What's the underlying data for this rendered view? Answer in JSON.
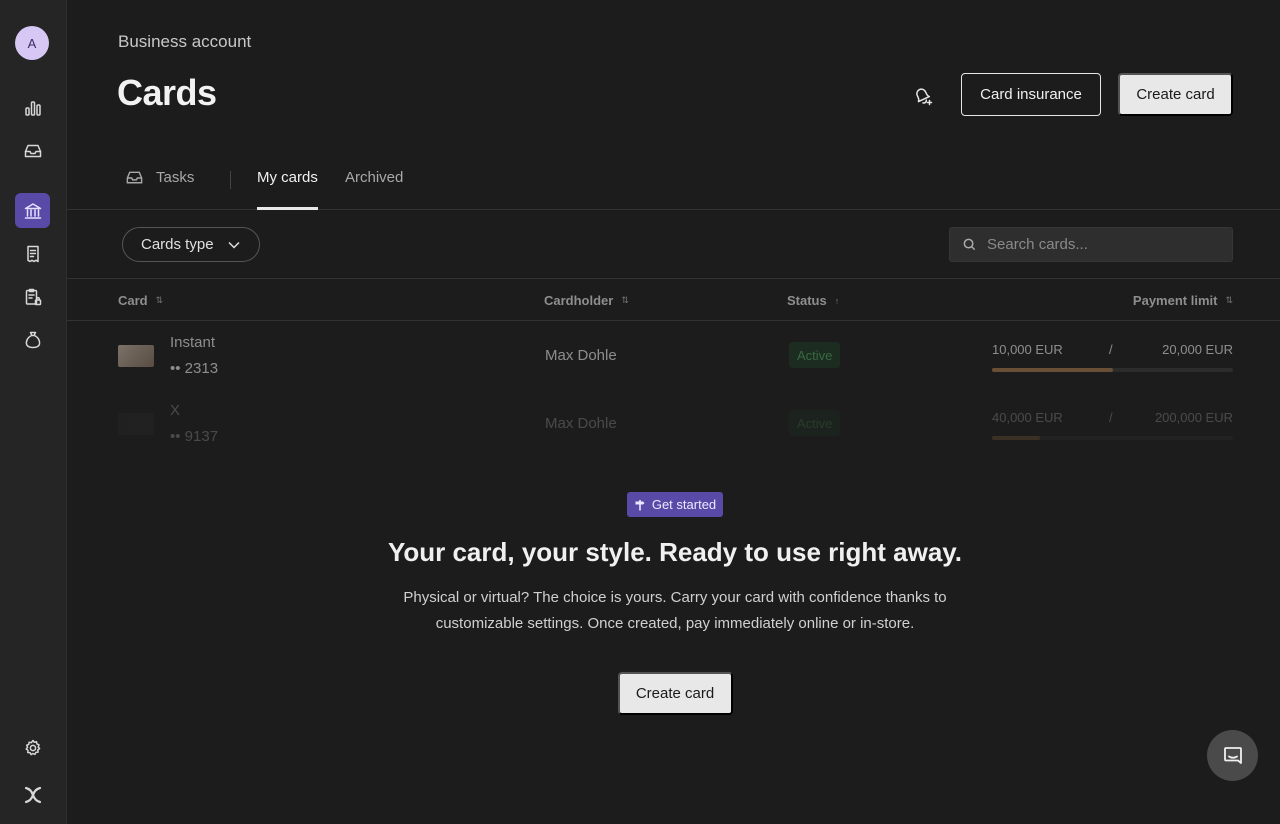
{
  "sidebar": {
    "avatar_initial": "A",
    "items": [
      {
        "icon": "bar-chart-icon"
      },
      {
        "icon": "inbox-icon"
      },
      {
        "icon": "bank-icon",
        "active": true
      },
      {
        "icon": "receipt-icon"
      },
      {
        "icon": "clipboard-lock-icon"
      },
      {
        "icon": "money-bag-icon"
      }
    ],
    "bottom": [
      {
        "icon": "gear-icon"
      },
      {
        "icon": "logo-icon"
      }
    ]
  },
  "header": {
    "eyebrow": "Business account",
    "title": "Cards",
    "insurance_label": "Card insurance",
    "create_label": "Create card"
  },
  "tabs": [
    {
      "label": "Tasks",
      "icon": "inbox-icon"
    },
    {
      "label": "My cards",
      "active": true
    },
    {
      "label": "Archived"
    }
  ],
  "filters": {
    "cards_type_label": "Cards type",
    "search_placeholder": "Search cards..."
  },
  "table": {
    "columns": [
      "Card",
      "Cardholder",
      "Status",
      "Payment limit"
    ],
    "rows": [
      {
        "name": "Instant",
        "number": "•• 2313",
        "holder": "Max Dohle",
        "status": "Active",
        "used": "10,000 EUR",
        "separator": "/",
        "total": "20,000 EUR",
        "progress": 0.5
      },
      {
        "name": "X",
        "number": "•• 9137",
        "holder": "Max Dohle",
        "status": "Active",
        "used": "40,000 EUR",
        "separator": "/",
        "total": "200,000 EUR",
        "progress": 0.2
      }
    ]
  },
  "empty_state": {
    "chip": "Get started",
    "title": "Your card, your style. Ready to use right away.",
    "text": "Physical or virtual? The choice is yours. Carry your card with confidence thanks to customizable settings. Once created, pay immediately online or in-store.",
    "cta": "Create card"
  },
  "colors": {
    "accent": "#5a4aa8",
    "status_active": "#4fa864",
    "progress": "#a8794a"
  }
}
